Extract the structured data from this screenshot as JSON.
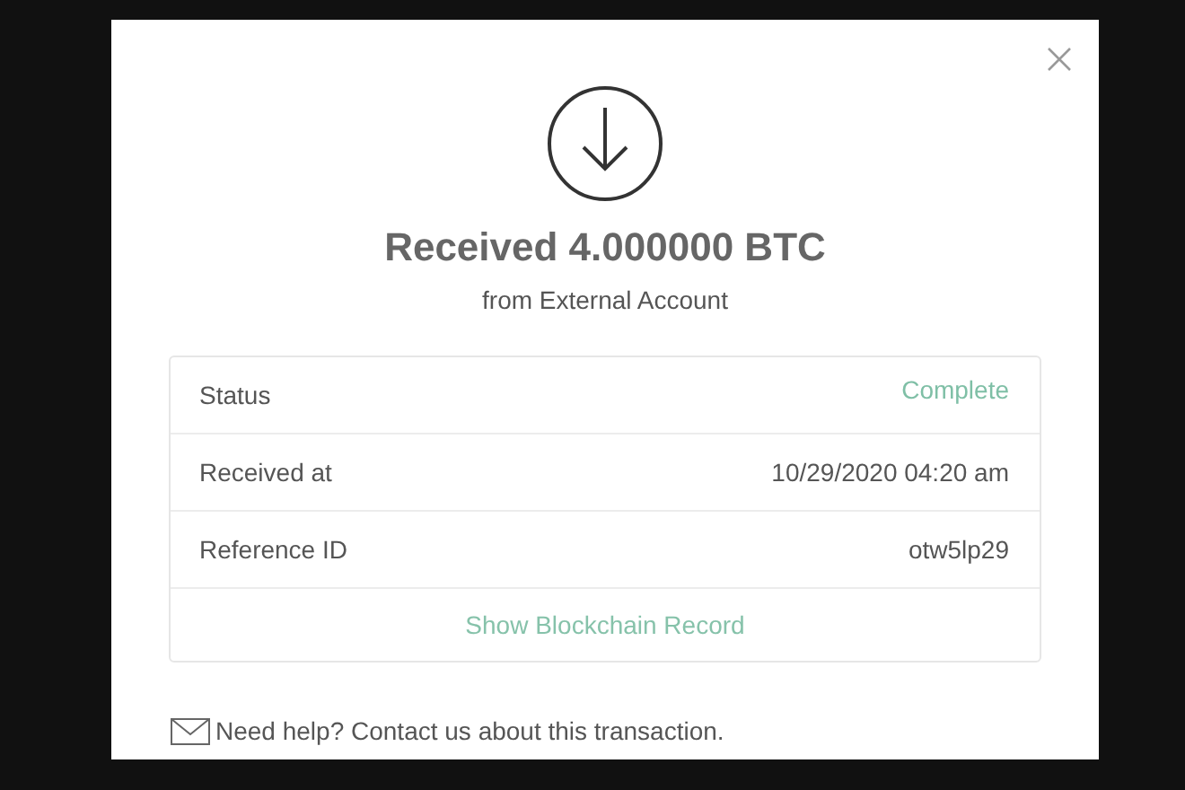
{
  "dialog": {
    "title": "Received 4.000000 BTC",
    "subtitle": "from External Account",
    "details": [
      {
        "kind": "status",
        "label": "Status",
        "value": "Complete"
      },
      {
        "kind": "text",
        "label": "Received at",
        "value": "10/29/2020 04:20 am"
      },
      {
        "kind": "text",
        "label": "Reference ID",
        "value": "otw5lp29"
      }
    ],
    "link": "Show Blockchain Record",
    "help": "Need help? Contact us about this transaction."
  }
}
